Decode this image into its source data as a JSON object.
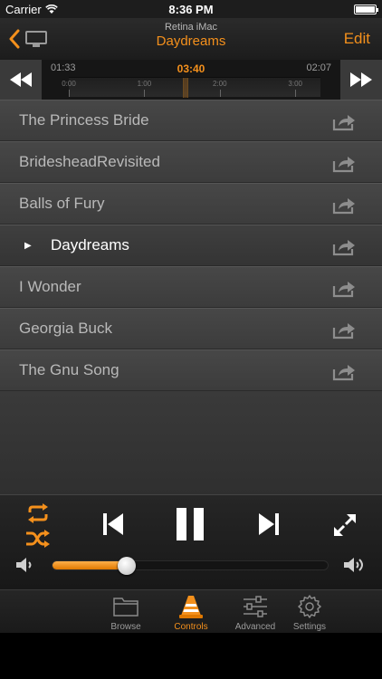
{
  "status_bar": {
    "carrier": "Carrier",
    "time": "8:36 PM"
  },
  "nav": {
    "subtitle": "Retina iMac",
    "title": "Daydreams",
    "edit_label": "Edit"
  },
  "timeline": {
    "elapsed": "01:33",
    "current": "03:40",
    "remaining": "02:07",
    "ticks": [
      "0:00",
      "1:00",
      "2:00",
      "3:00"
    ]
  },
  "playlist": {
    "items": [
      {
        "title": "The Princess Bride",
        "playing": false
      },
      {
        "title": "BridesheadRevisited",
        "playing": false
      },
      {
        "title": "Balls of Fury",
        "playing": false
      },
      {
        "title": "Daydreams",
        "playing": true
      },
      {
        "title": "I Wonder",
        "playing": false
      },
      {
        "title": "Georgia Buck",
        "playing": false
      },
      {
        "title": "The Gnu Song",
        "playing": false
      }
    ]
  },
  "player": {
    "volume": 0.27,
    "accent_color": "#f4901c"
  },
  "tabs": [
    {
      "label": "Browse",
      "icon": "folder-icon",
      "active": false
    },
    {
      "label": "Controls",
      "icon": "vlc-cone-icon",
      "active": true
    },
    {
      "label": "Advanced",
      "icon": "sliders-icon",
      "active": false
    },
    {
      "label": "Settings",
      "icon": "gear-icon",
      "active": false
    }
  ]
}
